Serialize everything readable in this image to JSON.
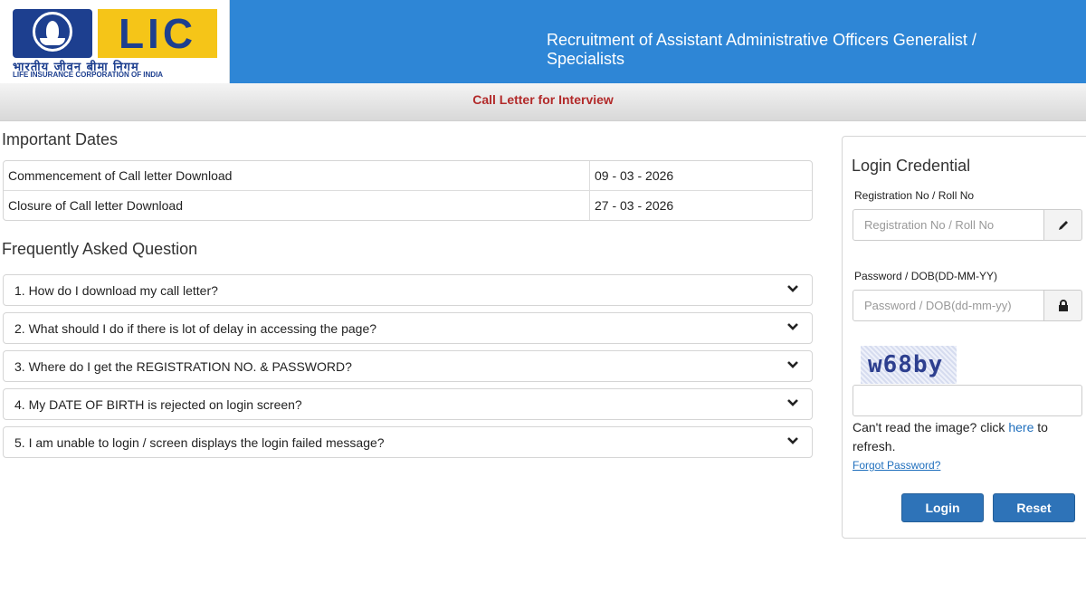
{
  "header": {
    "logo_text": "LIC",
    "logo_hindi": "भारतीय जीवन बीमा निगम",
    "logo_english": "LIFE INSURANCE CORPORATION OF INDIA",
    "title": "Recruitment of Assistant Administrative Officers Generalist / Specialists"
  },
  "subheader": {
    "title": "Call Letter for Interview"
  },
  "important_dates": {
    "heading": "Important Dates",
    "rows": [
      {
        "label": "Commencement of Call letter Download",
        "value": "09 - 03 - 2026"
      },
      {
        "label": "Closure of Call letter Download",
        "value": "27 - 03 - 2026"
      }
    ]
  },
  "faq": {
    "heading": "Frequently Asked Question",
    "items": [
      "1. How do I download my call letter?",
      "2. What should I do if there is lot of delay in accessing the page?",
      "3. Where do I get the REGISTRATION NO. & PASSWORD?",
      "4. My DATE OF BIRTH is rejected on login screen?",
      "5. I am unable to login / screen displays the login failed message?"
    ],
    "icon": "chevron-down-icon"
  },
  "login": {
    "heading": "Login Credential",
    "reg_label": "Registration No / Roll No",
    "reg_placeholder": "Registration No / Roll No",
    "reg_icon": "pencil-icon",
    "pwd_label": "Password / DOB(DD-MM-YY)",
    "pwd_placeholder": "Password / DOB(dd-mm-yy)",
    "pwd_icon": "lock-icon",
    "captcha_text": "w68by",
    "help_prefix": "Can't read the image? click ",
    "help_link": "here",
    "help_suffix": " to refresh.",
    "forgot_password": "Forgot Password?",
    "login_button": "Login",
    "reset_button": "Reset"
  },
  "colors": {
    "header_blue": "#2e86d6",
    "subheader_red": "#b22a2a",
    "button_blue": "#2e73b8",
    "logo_yellow": "#f5c518",
    "logo_navy": "#1d3f8f"
  }
}
